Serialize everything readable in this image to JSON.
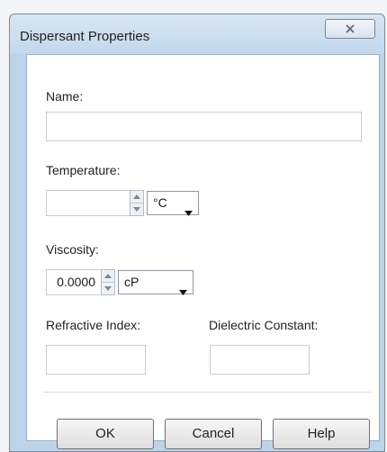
{
  "window": {
    "title": "Dispersant Properties"
  },
  "name": {
    "label": "Name:",
    "value": ""
  },
  "temperature": {
    "label": "Temperature:",
    "value": "",
    "unit": "°C"
  },
  "viscosity": {
    "label": "Viscosity:",
    "value": "0.0000",
    "unit": "cP"
  },
  "refractive_index": {
    "label": "Refractive Index:",
    "value": ""
  },
  "dielectric_constant": {
    "label": "Dielectric Constant:",
    "value": ""
  },
  "buttons": {
    "ok": "OK",
    "cancel": "Cancel",
    "help": "Help"
  },
  "icons": {
    "close": "close-icon",
    "spin_up": "spin-up-icon",
    "spin_down": "spin-down-icon",
    "dropdown": "chevron-down-icon"
  }
}
